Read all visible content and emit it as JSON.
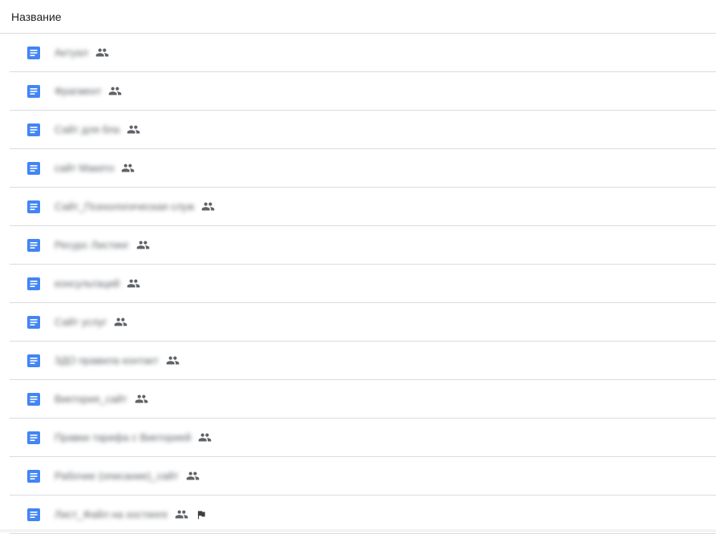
{
  "header": {
    "name_column_label": "Название"
  },
  "files": [
    {
      "name": "Актуал",
      "shared": true,
      "flag": false
    },
    {
      "name": "Фрагмент",
      "shared": true,
      "flag": false
    },
    {
      "name": "Сайт для бла",
      "shared": true,
      "flag": false
    },
    {
      "name": "сайт Макето",
      "shared": true,
      "flag": false
    },
    {
      "name": "Сайт_Психологическая служ",
      "shared": true,
      "flag": false
    },
    {
      "name": "Ресурс Листинг",
      "shared": true,
      "flag": false
    },
    {
      "name": "консультаций",
      "shared": true,
      "flag": false
    },
    {
      "name": "Сайт услуг",
      "shared": true,
      "flag": false
    },
    {
      "name": "ЗДО правила контакт",
      "shared": true,
      "flag": false
    },
    {
      "name": "Виктория_сайт",
      "shared": true,
      "flag": false
    },
    {
      "name": "Правки тарифа с Викторией",
      "shared": true,
      "flag": false
    },
    {
      "name": "Рабочие (описание)_сайт",
      "shared": true,
      "flag": false
    },
    {
      "name": "Лист_Файл на хостинге",
      "shared": true,
      "flag": true
    }
  ],
  "colors": {
    "doc_icon": "#4285f4",
    "divider": "#dadce0",
    "icon_gray": "#5f6368"
  },
  "icons": {
    "file": "google-docs-icon",
    "shared": "people-icon",
    "flag": "flag-icon"
  }
}
